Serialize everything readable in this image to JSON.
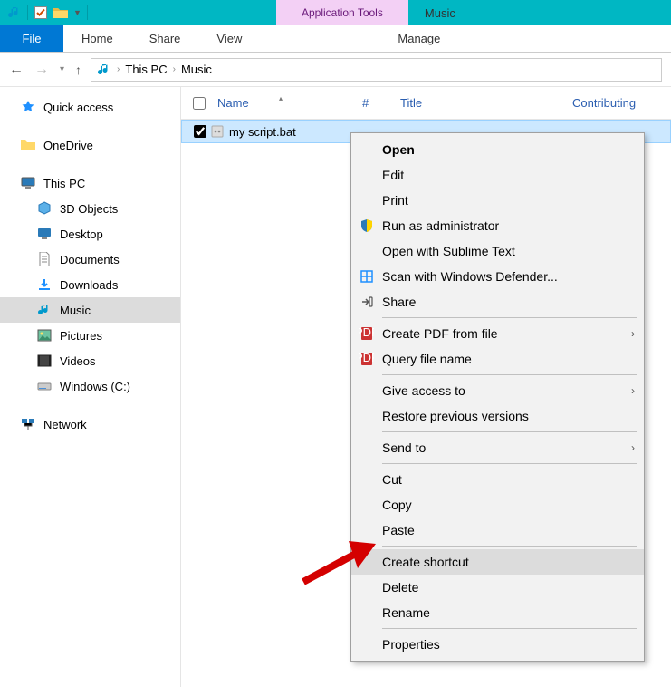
{
  "title_bar": {
    "app_tools_label": "Application Tools",
    "window_title": "Music"
  },
  "ribbon": {
    "file": "File",
    "tabs": [
      "Home",
      "Share",
      "View"
    ],
    "manage": "Manage"
  },
  "breadcrumb": {
    "segments": [
      "This PC",
      "Music"
    ]
  },
  "sidebar": {
    "quick_access": "Quick access",
    "onedrive": "OneDrive",
    "this_pc": "This PC",
    "children": [
      "3D Objects",
      "Desktop",
      "Documents",
      "Downloads",
      "Music",
      "Pictures",
      "Videos",
      "Windows (C:)"
    ],
    "network": "Network"
  },
  "columns": {
    "name": "Name",
    "num": "#",
    "title": "Title",
    "contrib": "Contributing"
  },
  "file_row": {
    "name": "my script.bat"
  },
  "context_menu": {
    "open": "Open",
    "edit": "Edit",
    "print": "Print",
    "run_admin": "Run as administrator",
    "open_sublime": "Open with Sublime Text",
    "scan_defender": "Scan with Windows Defender...",
    "share": "Share",
    "create_pdf": "Create PDF from file",
    "query_file": "Query file name",
    "give_access": "Give access to",
    "restore": "Restore previous versions",
    "send_to": "Send to",
    "cut": "Cut",
    "copy": "Copy",
    "paste": "Paste",
    "create_shortcut": "Create shortcut",
    "delete": "Delete",
    "rename": "Rename",
    "properties": "Properties"
  }
}
